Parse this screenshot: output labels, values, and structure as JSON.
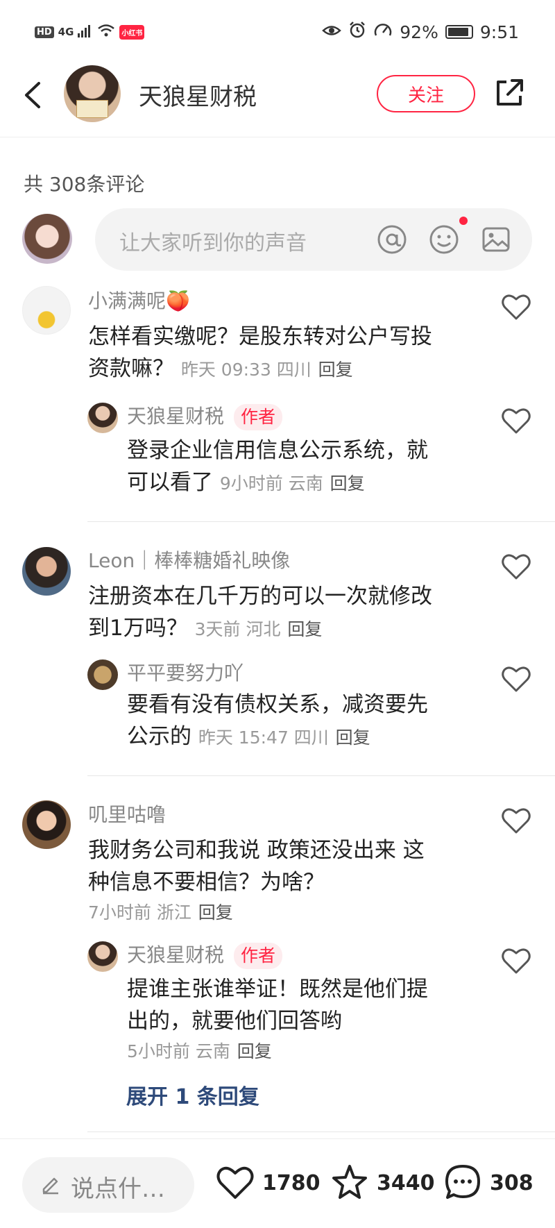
{
  "status_bar": {
    "hd": "HD",
    "network": "4G",
    "battery": "92%",
    "time": "9:51",
    "app_badge": "小红书"
  },
  "header": {
    "author_name": "天狼星财税",
    "follow_label": "关注"
  },
  "comments_header": {
    "count_text": "共 308条评论"
  },
  "input": {
    "placeholder": "让大家听到你的声音"
  },
  "comments": [
    {
      "name": "小满满呢🍑",
      "text": "怎样看实缴呢？是股东转对公户写投资款嘛？",
      "line1": "怎样看实缴呢？是股东转对公户写投",
      "line2": "资款嘛？",
      "meta": "昨天 09:33 四川",
      "reply": "回复",
      "replies": [
        {
          "name": "天狼星财税",
          "tag": "作者",
          "line1": "登录企业信用信息公示系统，就",
          "line2": "可以看了",
          "meta": "9小时前  云南",
          "reply": "回复"
        }
      ]
    },
    {
      "name": "Leon｜棒棒糖婚礼映像",
      "line1": "注册资本在几千万的可以一次就修改",
      "line2": "到1万吗？",
      "meta": "3天前  河北",
      "reply": "回复",
      "replies": [
        {
          "name": "平平要努力吖",
          "line1": "要看有没有债权关系，减资要先",
          "line2": "公示的",
          "meta": "昨天 15:47 四川",
          "reply": "回复"
        }
      ]
    },
    {
      "name": "叽里咕噜",
      "line1": "我财务公司和我说 政策还没出来 这",
      "line2": "种信息不要相信？为啥？",
      "meta": "7小时前  浙江",
      "reply": "回复",
      "replies": [
        {
          "name": "天狼星财税",
          "tag": "作者",
          "line1": "提谁主张谁举证！既然是他们提",
          "line2": "出的，就要他们回答哟",
          "meta": "5小时前  云南",
          "reply": "回复"
        }
      ],
      "expand_label": "展开 1 条回复"
    }
  ],
  "bottom_bar": {
    "say_placeholder": "说点什…",
    "likes": "1780",
    "favorites": "3440",
    "comments": "308"
  },
  "colors": {
    "accent": "#ff2442",
    "link": "#2e4a7a"
  }
}
